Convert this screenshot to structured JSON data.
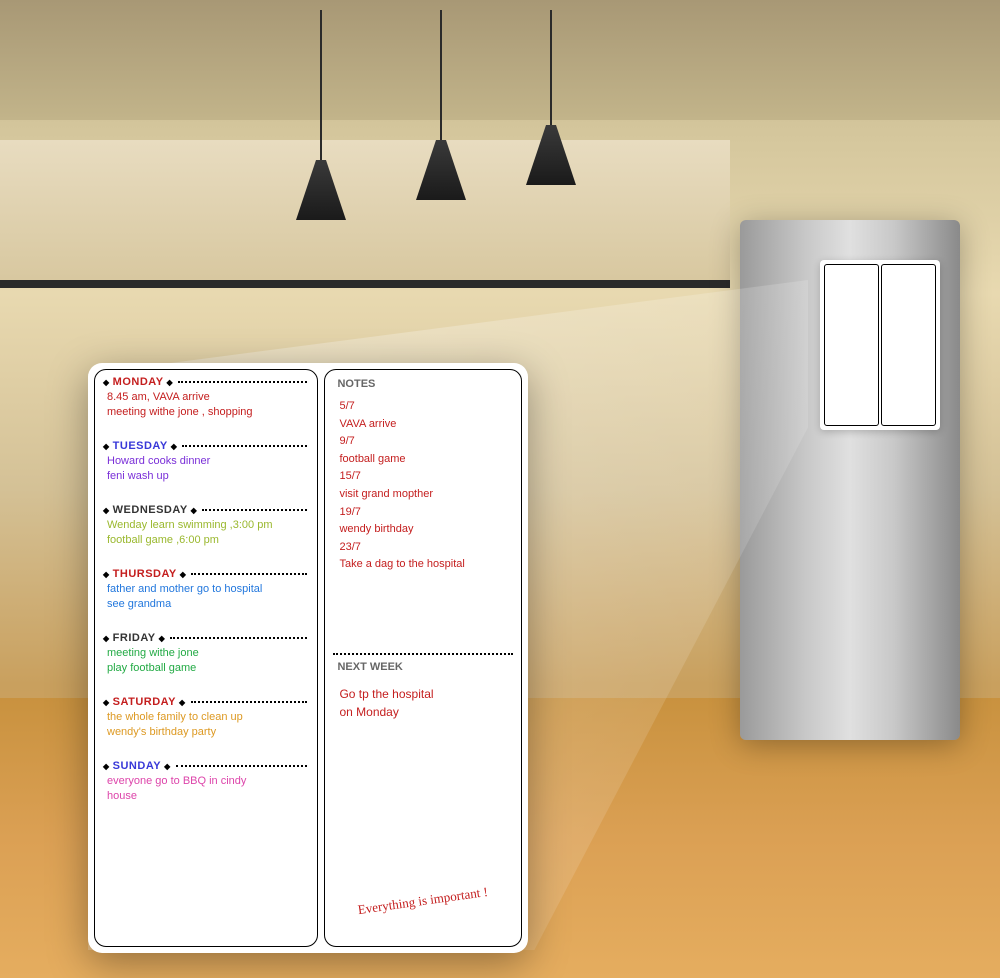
{
  "planner": {
    "days": [
      {
        "name": "MONDAY",
        "color": "#c41e1e",
        "lines": [
          "8.45 am, VAVA arrive",
          "meeting withe jone , shopping"
        ],
        "textColor": "#c41e1e"
      },
      {
        "name": "TUESDAY",
        "color": "#3838d8",
        "lines": [
          "Howard cooks dinner",
          "feni wash up"
        ],
        "textColor": "#7a2fd8"
      },
      {
        "name": "WEDNESDAY",
        "color": "#333",
        "lines": [
          "Wenday learn swimming ,3:00 pm",
          "football game ,6:00 pm"
        ],
        "textColor": "#9ab82e"
      },
      {
        "name": "THURSDAY",
        "color": "#c41e1e",
        "lines": [
          "father and mother go to hospital",
          "see grandma"
        ],
        "textColor": "#2277dd"
      },
      {
        "name": "FRIDAY",
        "color": "#333",
        "lines": [
          "meeting withe jone",
          "play football game"
        ],
        "textColor": "#22aa44"
      },
      {
        "name": "SATURDAY",
        "color": "#c41e1e",
        "lines": [
          "the whole family to clean up",
          "wendy's birthday party"
        ],
        "textColor": "#dd9922"
      },
      {
        "name": "SUNDAY",
        "color": "#3838d8",
        "lines": [
          "everyone go to  BBQ  in cindy",
          "house"
        ],
        "textColor": "#dd44aa"
      }
    ],
    "notes": {
      "title": "NOTES",
      "lines": [
        "5/7",
        "VAVA  arrive",
        "9/7",
        "football  game",
        "15/7",
        "visit grand mopther",
        "19/7",
        "wendy birthday",
        "23/7",
        "Take a dag to the hospital"
      ],
      "textColor": "#c41e1e"
    },
    "nextweek": {
      "title": "NEXT WEEK",
      "lines": [
        "Go tp the hospital",
        "on Monday"
      ],
      "footer": "Everything is important !"
    }
  }
}
